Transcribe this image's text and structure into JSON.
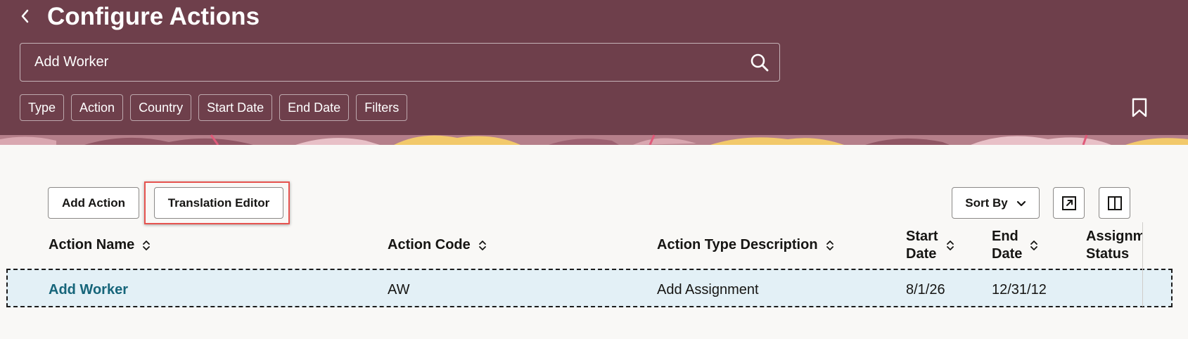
{
  "header": {
    "title": "Configure Actions",
    "search": {
      "value": "Add Worker",
      "placeholder": ""
    },
    "filters": [
      "Type",
      "Action",
      "Country",
      "Start Date",
      "End Date",
      "Filters"
    ]
  },
  "toolbar": {
    "add_action": "Add Action",
    "translation_editor": "Translation Editor",
    "sort_by": "Sort By"
  },
  "table": {
    "columns": {
      "action_name": "Action Name",
      "action_code": "Action Code",
      "action_type_description": "Action Type Description",
      "start_date": [
        "Start",
        "Date"
      ],
      "end_date": [
        "End",
        "Date"
      ],
      "assignment_status": [
        "Assignm",
        "Status"
      ]
    },
    "rows": [
      {
        "action_name": "Add Worker",
        "action_code": "AW",
        "action_type_description": "Add Assignment",
        "start_date": "8/1/26",
        "end_date": "12/31/12",
        "assignment_status": ""
      }
    ]
  },
  "colors": {
    "header_bg": "#6e3f4b",
    "link": "#16657a",
    "row_selected": "#e3f0f6",
    "highlight": "#e6534f"
  },
  "icons": [
    "back-icon",
    "search-icon",
    "bookmark-icon",
    "chevron-down-icon",
    "export-icon",
    "columns-icon",
    "sort-icon"
  ]
}
